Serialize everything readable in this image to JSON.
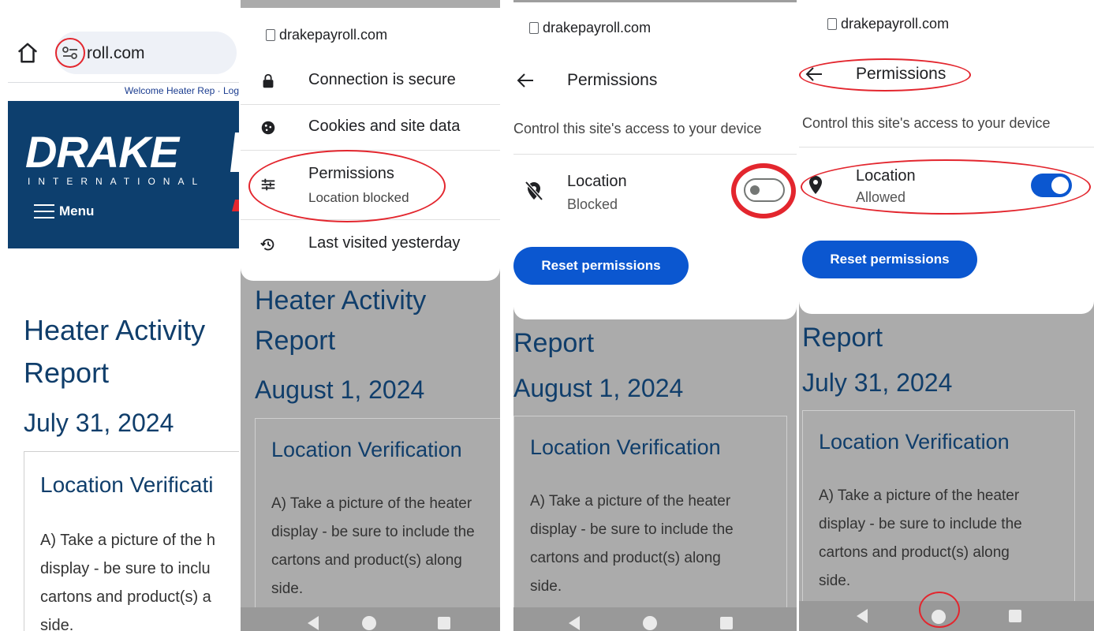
{
  "panel1": {
    "omnibox_text": "roll.com",
    "welcome": "Welcome Heater Rep · Log",
    "logo_main": "DRAKE",
    "logo_sub": "INTERNATIONAL",
    "menu_label": "Menu",
    "title_line1": "Heater Activity",
    "title_line2": "Report",
    "date": "July 31, 2024",
    "card_title": "Location Verificati",
    "card_lines": [
      "A) Take a picture of the h",
      "display - be sure to inclu",
      "cartons and product(s) a",
      "side."
    ]
  },
  "panel2": {
    "url": "drakepayroll.com",
    "menu": [
      {
        "label": "Connection is secure",
        "icon": "lock-icon"
      },
      {
        "label": "Cookies and site data",
        "icon": "cookie-icon"
      },
      {
        "label": "Permissions",
        "sub": "Location blocked",
        "icon": "tune-icon"
      },
      {
        "label": "Last visited yesterday",
        "icon": "history-icon"
      }
    ],
    "title_line1": "Heater Activity",
    "title_line2": "Report",
    "date": "August 1, 2024",
    "card_title": "Location Verification",
    "card_lines": [
      "A) Take a picture of the heater",
      "display - be sure to include the",
      "cartons and product(s) along",
      "side."
    ]
  },
  "panel3": {
    "url": "drakepayroll.com",
    "header": "Permissions",
    "description": "Control this site's access to your device",
    "location_label": "Location",
    "location_status": "Blocked",
    "toggle_on": false,
    "reset_label": "Reset permissions",
    "title_line2": "Report",
    "date": "August 1, 2024",
    "card_title": "Location Verification",
    "card_lines": [
      "A) Take a picture of the heater",
      "display - be sure to include the",
      "cartons and product(s) along",
      "side."
    ]
  },
  "panel4": {
    "url": "drakepayroll.com",
    "header": "Permissions",
    "description": "Control this site's access to your device",
    "location_label": "Location",
    "location_status": "Allowed",
    "toggle_on": true,
    "reset_label": "Reset permissions",
    "title_line2": "Report",
    "date": "July 31, 2024",
    "card_title": "Location Verification",
    "card_lines": [
      "A) Take a picture of the heater",
      "display - be sure to include the",
      "cartons and product(s) along",
      "side."
    ]
  },
  "colors": {
    "brand_navy": "#0d3f6e",
    "heading": "#103e6b",
    "annotation_red": "#e3262e",
    "toggle_blue": "#0b57d0"
  }
}
